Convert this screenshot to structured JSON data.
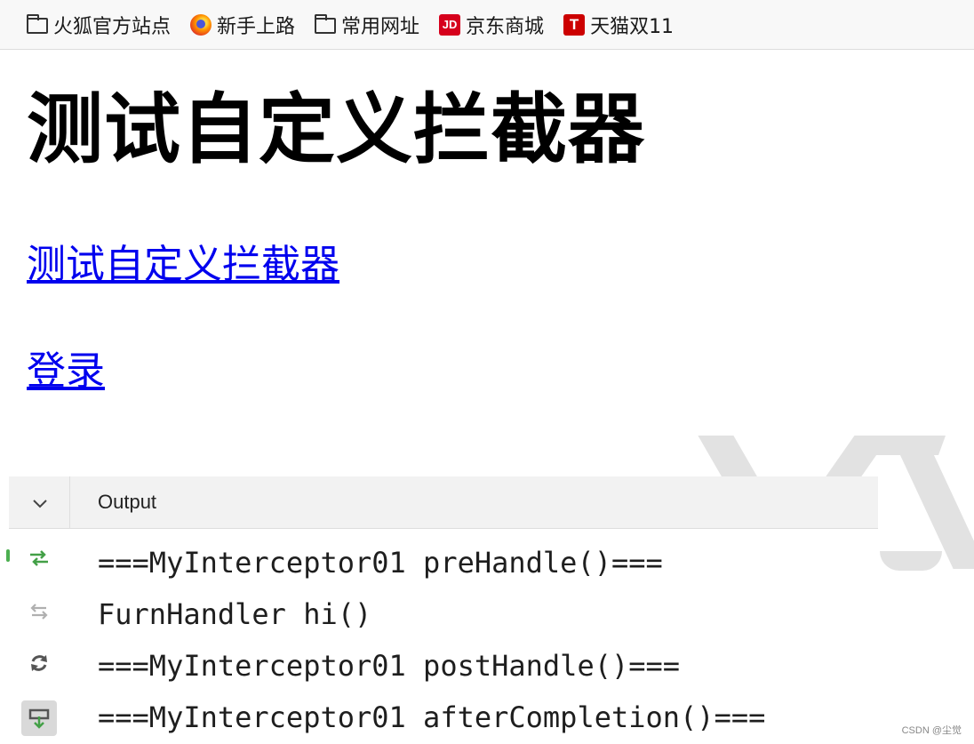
{
  "bookmarks": [
    {
      "label": "火狐官方站点",
      "icon": "folder-icon"
    },
    {
      "label": "新手上路",
      "icon": "firefox-icon"
    },
    {
      "label": "常用网址",
      "icon": "folder-icon"
    },
    {
      "label": "京东商城",
      "icon": "jd-icon",
      "icon_text": "JD"
    },
    {
      "label": "天猫双11",
      "icon": "tmall-icon",
      "icon_text": "T"
    }
  ],
  "page": {
    "heading": "测试自定义拦截器",
    "link_interceptor": "测试自定义拦截器",
    "link_login": "登录",
    "link_color": "#0000ee"
  },
  "output_panel": {
    "title": "Output",
    "toolbar_icons": [
      "rerun-icon",
      "restore-icon",
      "refresh-icon",
      "scroll-to-end-icon"
    ],
    "lines": [
      "===MyInterceptor01 preHandle()===",
      "FurnHandler hi()",
      "===MyInterceptor01 postHandle()===",
      "===MyInterceptor01 afterCompletion()==="
    ]
  },
  "watermark": "CSDN @尘觉"
}
